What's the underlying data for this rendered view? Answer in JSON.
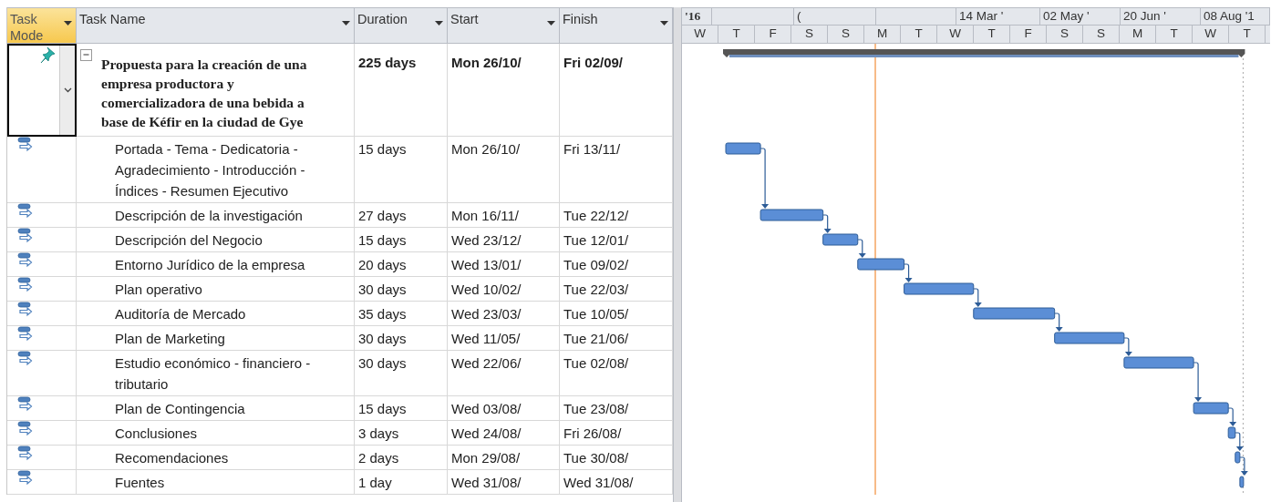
{
  "columns": [
    {
      "label": "Task Mode",
      "selected": true
    },
    {
      "label": "Task Name",
      "selected": false
    },
    {
      "label": "Duration",
      "selected": false
    },
    {
      "label": "Start",
      "selected": false
    },
    {
      "label": "Finish",
      "selected": false
    }
  ],
  "timescale": {
    "top": [
      "'16",
      "(",
      "14 Mar '",
      "02 May '",
      "20 Jun '",
      "08 Aug '1"
    ],
    "bottom": [
      "W",
      "T",
      "F",
      "S",
      "S",
      "M",
      "T",
      "W",
      "T",
      "F",
      "S",
      "S",
      "M",
      "T",
      "W",
      "T"
    ]
  },
  "tasks": [
    {
      "kind": "summary",
      "manually_scheduled": true,
      "selected": true,
      "expanded": true,
      "name": "Propuesta para la creación de una empresa productora y comercializadora de una bebida a base de Kéfir en la ciudad de Gye",
      "duration": "225 days",
      "start": "Mon 26/10/",
      "finish": "Fri 02/09/"
    },
    {
      "kind": "task",
      "manually_scheduled": false,
      "selected": false,
      "name": "Portada - Tema - Dedicatoria - Agradecimiento - Introducción - Índices - Resumen Ejecutivo",
      "duration": "15 days",
      "start": "Mon 26/10/",
      "finish": "Fri 13/11/"
    },
    {
      "kind": "task",
      "manually_scheduled": false,
      "selected": false,
      "name": "Descripción de la investigación",
      "duration": "27 days",
      "start": "Mon 16/11/",
      "finish": "Tue 22/12/"
    },
    {
      "kind": "task",
      "manually_scheduled": false,
      "selected": false,
      "name": "Descripción del Negocio",
      "duration": "15 days",
      "start": "Wed 23/12/",
      "finish": "Tue 12/01/"
    },
    {
      "kind": "task",
      "manually_scheduled": false,
      "selected": false,
      "name": "Entorno Jurídico de la empresa",
      "duration": "20 days",
      "start": "Wed 13/01/",
      "finish": "Tue 09/02/"
    },
    {
      "kind": "task",
      "manually_scheduled": false,
      "selected": false,
      "name": "Plan operativo",
      "duration": "30 days",
      "start": "Wed 10/02/",
      "finish": "Tue 22/03/"
    },
    {
      "kind": "task",
      "manually_scheduled": false,
      "selected": false,
      "name": "Auditoría de Mercado",
      "duration": "35 days",
      "start": "Wed 23/03/",
      "finish": "Tue 10/05/"
    },
    {
      "kind": "task",
      "manually_scheduled": false,
      "selected": false,
      "name": "Plan de Marketing",
      "duration": "30 days",
      "start": "Wed 11/05/",
      "finish": "Tue 21/06/"
    },
    {
      "kind": "task",
      "manually_scheduled": false,
      "selected": false,
      "name": "Estudio económico - financiero - tributario",
      "duration": "30 days",
      "start": "Wed 22/06/",
      "finish": "Tue 02/08/"
    },
    {
      "kind": "task",
      "manually_scheduled": false,
      "selected": false,
      "name": "Plan de Contingencia",
      "duration": "15 days",
      "start": "Wed 03/08/",
      "finish": "Tue 23/08/"
    },
    {
      "kind": "task",
      "manually_scheduled": false,
      "selected": false,
      "name": "Conclusiones",
      "duration": "3 days",
      "start": "Wed 24/08/",
      "finish": "Fri 26/08/"
    },
    {
      "kind": "task",
      "manually_scheduled": false,
      "selected": false,
      "name": "Recomendaciones",
      "duration": "2 days",
      "start": "Mon 29/08/",
      "finish": "Tue 30/08/"
    },
    {
      "kind": "task",
      "manually_scheduled": false,
      "selected": false,
      "name": "Fuentes",
      "duration": "1 day",
      "start": "Wed 31/08/",
      "finish": "Wed 31/08/"
    }
  ]
}
